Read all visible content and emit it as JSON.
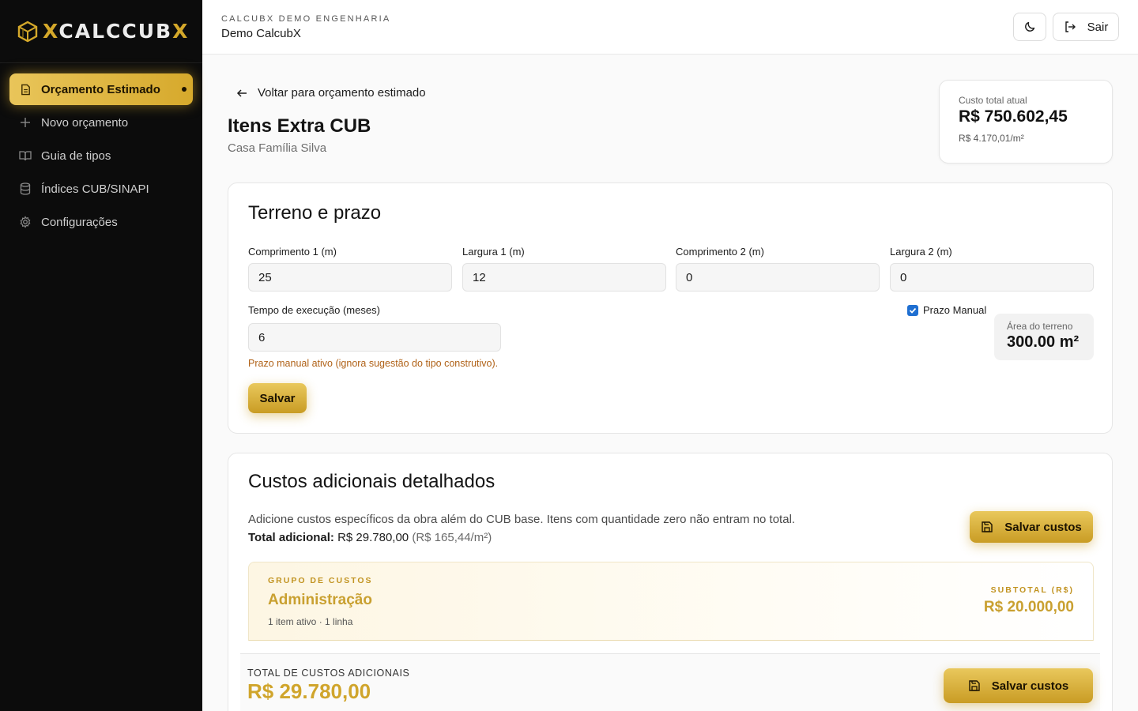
{
  "app": {
    "logo_text": "CALCCUB",
    "logo_x": "X"
  },
  "sidebar": {
    "items": [
      {
        "label": "Orçamento Estimado",
        "icon": "document-icon",
        "active": true
      },
      {
        "label": "Novo orçamento",
        "icon": "plus-icon",
        "active": false
      },
      {
        "label": "Guia de tipos",
        "icon": "book-icon",
        "active": false
      },
      {
        "label": "Índices CUB/SINAPI",
        "icon": "database-icon",
        "active": false
      },
      {
        "label": "Configurações",
        "icon": "gear-icon",
        "active": false
      }
    ]
  },
  "header": {
    "company_sub": "CALCUBX DEMO ENGENHARIA",
    "company_name": "Demo CalcubX",
    "logout_label": "Sair"
  },
  "page": {
    "back_label": "Voltar para orçamento estimado",
    "title": "Itens Extra CUB",
    "subtitle": "Casa Família Silva"
  },
  "cost_card": {
    "label": "Custo total atual",
    "value": "R$ 750.602,45",
    "per_m2": "R$ 4.170,01/m²"
  },
  "terrain": {
    "title": "Terreno e prazo",
    "fields": [
      {
        "label": "Comprimento 1 (m)",
        "value": "25"
      },
      {
        "label": "Largura 1 (m)",
        "value": "12"
      },
      {
        "label": "Comprimento 2 (m)",
        "value": "0"
      },
      {
        "label": "Largura 2 (m)",
        "value": "0"
      }
    ],
    "time_label": "Tempo de execução (meses)",
    "time_value": "6",
    "manual_checkbox_label": "Prazo Manual",
    "manual_checked": true,
    "area_label": "Área do terreno",
    "area_value": "300.00 m²",
    "manual_note": "Prazo manual ativo (ignora sugestão do tipo construtivo).",
    "save_label": "Salvar"
  },
  "extra_costs": {
    "title": "Custos adicionais detalhados",
    "description": "Adicione custos específicos da obra além do CUB base. Itens com quantidade zero não entram no total.",
    "total_label": "Total adicional:",
    "total_value": "R$ 29.780,00",
    "total_per_m2": "(R$ 165,44/m²)",
    "save_label": "Salvar custos",
    "group": {
      "tag": "GRUPO DE CUSTOS",
      "name": "Administração",
      "meta": "1 item ativo · 1 linha",
      "subtotal_tag": "SUBTOTAL (R$)",
      "subtotal_value": "R$ 20.000,00"
    }
  },
  "bottom_bar": {
    "label": "TOTAL DE CUSTOS ADICIONAIS",
    "value": "R$ 29.780,00",
    "save_label": "Salvar custos"
  },
  "colors": {
    "accent": "#d6a92c",
    "sidebar_bg": "#0c0c0c",
    "warning_text": "#b06218"
  }
}
